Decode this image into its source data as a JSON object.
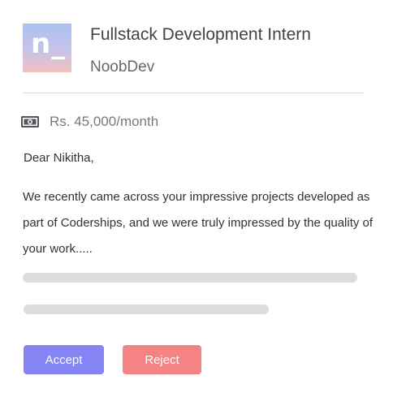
{
  "company_logo": {
    "text": "n_",
    "gradient_colors": [
      "#a8c3f0",
      "#c7c2e8",
      "#f2c1bd"
    ]
  },
  "job": {
    "title": "Fullstack Development Intern",
    "company": "NoobDev",
    "salary": "Rs. 45,000/month",
    "salary_icon": "money-icon"
  },
  "message": {
    "greeting": "Dear Nikitha,",
    "body": "We recently came across your impressive projects developed as part of Coderships, and we were truly impressed by the quality of your work....."
  },
  "actions": {
    "accept_label": "Accept",
    "reject_label": "Reject"
  },
  "colors": {
    "accept": "#8584f5",
    "reject": "#f58383",
    "skeleton": "#dcdbdd"
  }
}
